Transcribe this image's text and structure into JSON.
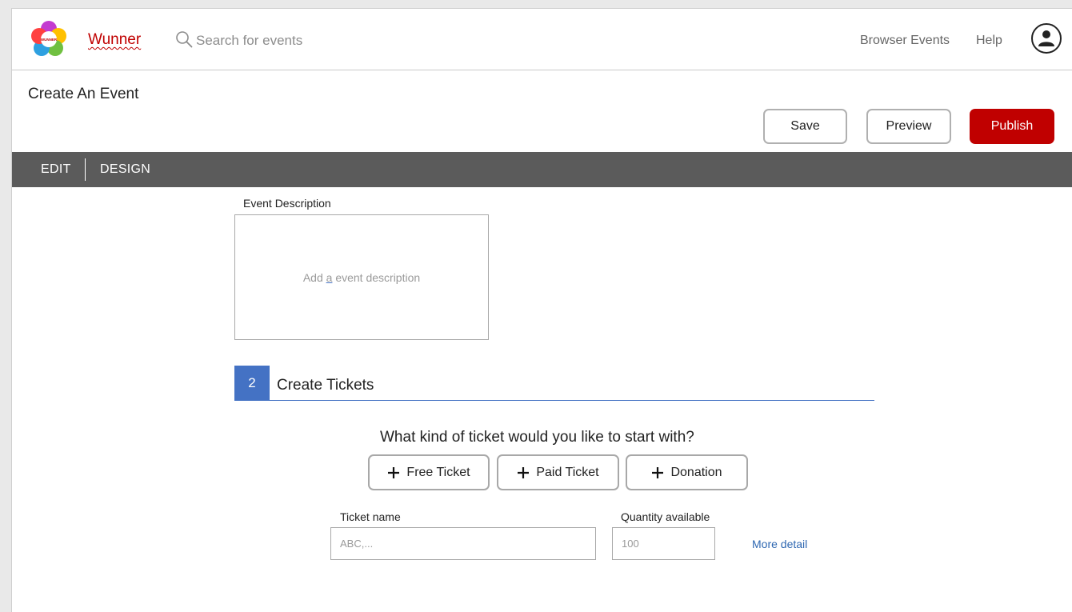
{
  "header": {
    "brand": "Wunner",
    "logo_text": "WUNNER",
    "search_placeholder": "Search for events",
    "nav": {
      "browse": "Browser Events",
      "help": "Help"
    }
  },
  "page": {
    "title": "Create An Event"
  },
  "actions": {
    "save": "Save",
    "preview": "Preview",
    "publish": "Publish"
  },
  "tabs": [
    {
      "label": "EDIT"
    },
    {
      "label": "DESIGN"
    }
  ],
  "description": {
    "label": "Event Description",
    "placeholder_pre": "Add ",
    "placeholder_u": "a",
    "placeholder_post": " event description"
  },
  "tickets_section": {
    "number": "2",
    "title": "Create Tickets",
    "question": "What kind of ticket would you like to start with?",
    "types": [
      {
        "label": "Free Ticket"
      },
      {
        "label": "Paid Ticket"
      },
      {
        "label": "Donation"
      }
    ],
    "ticket_name_label": "Ticket name",
    "ticket_name_placeholder": "ABC,...",
    "quantity_label": "Quantity available",
    "quantity_placeholder": "100",
    "more_detail": "More detail"
  },
  "colors": {
    "brand_red": "#c00000",
    "tab_bar": "#5b5b5b",
    "section_blue": "#4472c4",
    "link_blue": "#2e67b1"
  },
  "icons": {
    "logo": "flower-logo-icon",
    "search": "search-icon",
    "avatar": "user-icon",
    "plus": "plus-icon"
  }
}
